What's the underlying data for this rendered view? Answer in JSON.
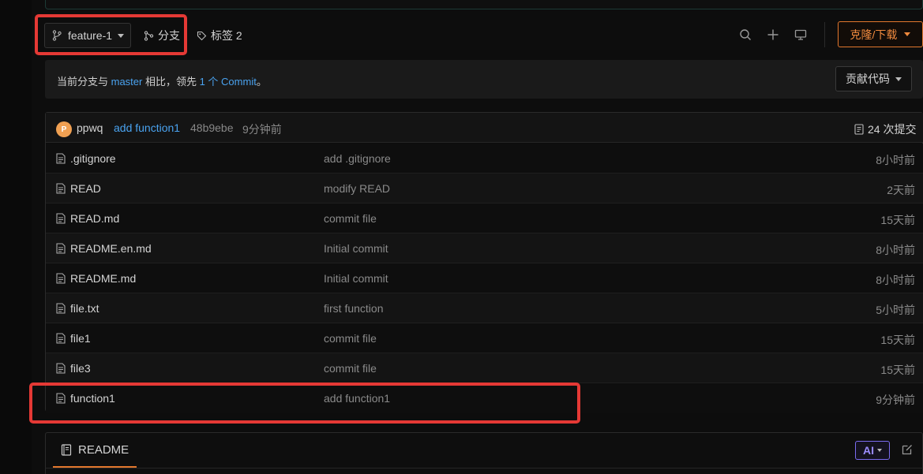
{
  "toolbar": {
    "branch": "feature-1",
    "branches_label": "分支",
    "tags_label": "标签 2",
    "clone_label": "克隆/下载"
  },
  "compare": {
    "prefix": "当前分支与 ",
    "base_branch": "master",
    "middle": " 相比，领先 ",
    "ahead": "1 个 Commit",
    "suffix": "。",
    "contribute_label": "贡献代码"
  },
  "latest_commit": {
    "avatar_letter": "P",
    "author": "ppwq",
    "message": "add function1",
    "hash": "48b9ebe",
    "time": "9分钟前",
    "count_label": "24 次提交"
  },
  "files": [
    {
      "name": ".gitignore",
      "message": "add .gitignore",
      "time": "8小时前"
    },
    {
      "name": "READ",
      "message": "modify READ",
      "time": "2天前"
    },
    {
      "name": "READ.md",
      "message": "commit file",
      "time": "15天前"
    },
    {
      "name": "README.en.md",
      "message": "Initial commit",
      "time": "8小时前"
    },
    {
      "name": "README.md",
      "message": "Initial commit",
      "time": "8小时前"
    },
    {
      "name": "file.txt",
      "message": "first function",
      "time": "5小时前"
    },
    {
      "name": "file1",
      "message": "commit file",
      "time": "15天前"
    },
    {
      "name": "file3",
      "message": "commit file",
      "time": "15天前"
    },
    {
      "name": "function1",
      "message": "add function1",
      "time": "9分钟前"
    }
  ],
  "readme": {
    "tab_label": "README",
    "ai_label": "AI"
  },
  "colors": {
    "accent": "#e2772d",
    "link": "#4aa3f0",
    "highlight": "#e53935"
  },
  "icons": [
    "branch-icon",
    "branches-icon",
    "tag-icon",
    "search-icon",
    "plus-icon",
    "monitor-icon",
    "commits-icon",
    "file-icon",
    "book-icon",
    "edit-icon"
  ]
}
